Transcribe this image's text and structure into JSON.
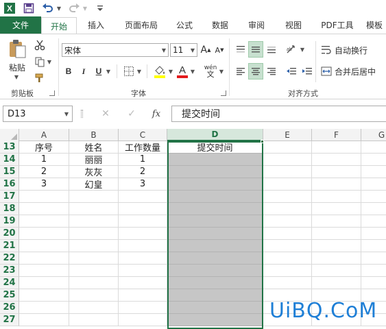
{
  "colors": {
    "excel_green": "#217346",
    "selection_fill": "#c6c6c6",
    "header_bg": "#f3f3f3",
    "watermark": "#1f7fd6"
  },
  "qat": {
    "icons": [
      "excel-logo-icon",
      "save-icon",
      "undo-icon",
      "redo-icon",
      "customize-qat-icon"
    ],
    "logo_letter": "X"
  },
  "tabs": [
    {
      "label": "文件"
    },
    {
      "label": "开始"
    },
    {
      "label": "插入"
    },
    {
      "label": "页面布局"
    },
    {
      "label": "公式"
    },
    {
      "label": "数据"
    },
    {
      "label": "审阅"
    },
    {
      "label": "视图"
    },
    {
      "label": "PDF工具"
    },
    {
      "label": "模板"
    }
  ],
  "ribbon": {
    "clipboard": {
      "paste_label": "粘贴",
      "group_label": "剪贴板"
    },
    "font": {
      "font_name": "宋体",
      "font_size": "11",
      "bold": "B",
      "italic": "I",
      "underline": "U",
      "grow": "A",
      "shrink": "A",
      "font_color_letter": "A",
      "phonetic": "wén",
      "group_label": "字体"
    },
    "alignment": {
      "wrap_text": "自动换行",
      "merge_center": "合并后居中",
      "group_label": "对齐方式"
    }
  },
  "formula_bar": {
    "name_box": "D13",
    "cancel": "✕",
    "enter": "✓",
    "fx": "fx",
    "formula": "提交时间"
  },
  "grid": {
    "columns": [
      "A",
      "B",
      "C",
      "D",
      "E",
      "F",
      "G"
    ],
    "selected_column": "D",
    "rows": [
      {
        "n": "13",
        "cells": [
          "序号",
          "姓名",
          "工作数量",
          "提交时间",
          "",
          "",
          ""
        ]
      },
      {
        "n": "14",
        "cells": [
          "1",
          "丽丽",
          "1",
          "",
          "",
          "",
          ""
        ]
      },
      {
        "n": "15",
        "cells": [
          "2",
          "灰灰",
          "2",
          "",
          "",
          "",
          ""
        ]
      },
      {
        "n": "16",
        "cells": [
          "3",
          "幻皇",
          "3",
          "",
          "",
          "",
          ""
        ]
      },
      {
        "n": "17",
        "cells": [
          "",
          "",
          "",
          "",
          "",
          "",
          ""
        ]
      },
      {
        "n": "18",
        "cells": [
          "",
          "",
          "",
          "",
          "",
          "",
          ""
        ]
      },
      {
        "n": "19",
        "cells": [
          "",
          "",
          "",
          "",
          "",
          "",
          ""
        ]
      },
      {
        "n": "20",
        "cells": [
          "",
          "",
          "",
          "",
          "",
          "",
          ""
        ]
      },
      {
        "n": "21",
        "cells": [
          "",
          "",
          "",
          "",
          "",
          "",
          ""
        ]
      },
      {
        "n": "22",
        "cells": [
          "",
          "",
          "",
          "",
          "",
          "",
          ""
        ]
      },
      {
        "n": "23",
        "cells": [
          "",
          "",
          "",
          "",
          "",
          "",
          ""
        ]
      },
      {
        "n": "24",
        "cells": [
          "",
          "",
          "",
          "",
          "",
          "",
          ""
        ]
      },
      {
        "n": "25",
        "cells": [
          "",
          "",
          "",
          "",
          "",
          "",
          ""
        ]
      },
      {
        "n": "26",
        "cells": [
          "",
          "",
          "",
          "",
          "",
          "",
          ""
        ]
      },
      {
        "n": "27",
        "cells": [
          "",
          "",
          "",
          "",
          "",
          "",
          ""
        ]
      }
    ]
  },
  "watermark": "UiBQ.CoM"
}
